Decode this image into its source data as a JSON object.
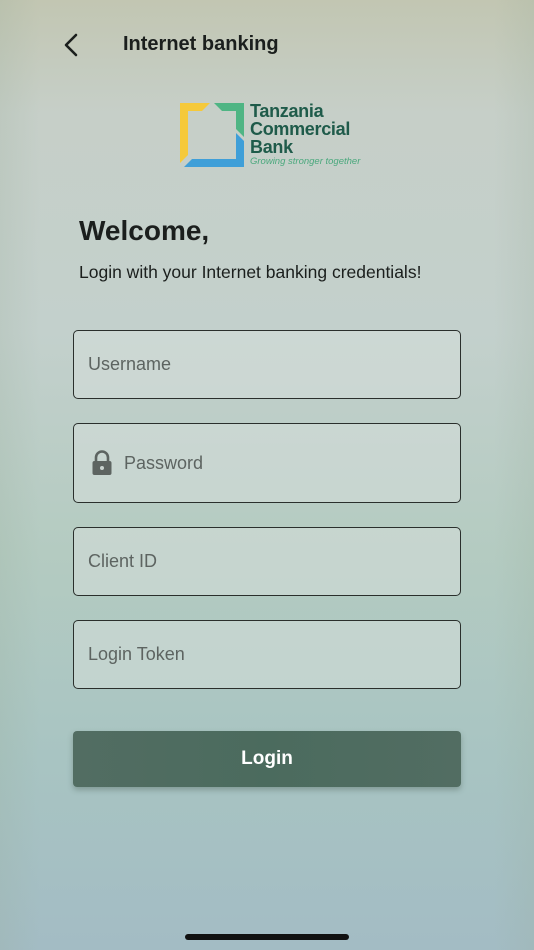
{
  "header": {
    "title": "Internet banking",
    "back_icon": "chevron-left-icon"
  },
  "logo": {
    "line1": "Tanzania",
    "line2": "Commercial",
    "line3": "Bank",
    "tagline": "Growing stronger together",
    "colors": {
      "yellow": "#f5c93a",
      "green": "#4fb584",
      "blue": "#3f9fd8",
      "text": "#1f5b4a"
    }
  },
  "welcome": {
    "title": "Welcome,",
    "subtitle": "Login with your Internet banking credentials!"
  },
  "form": {
    "username_placeholder": "Username",
    "password_placeholder": "Password",
    "password_icon": "lock-icon",
    "client_id_placeholder": "Client ID",
    "login_token_placeholder": "Login Token",
    "login_label": "Login"
  },
  "colors": {
    "button": "#4b6b5e",
    "border": "#2a2f2c",
    "text": "#1b1f1d"
  }
}
